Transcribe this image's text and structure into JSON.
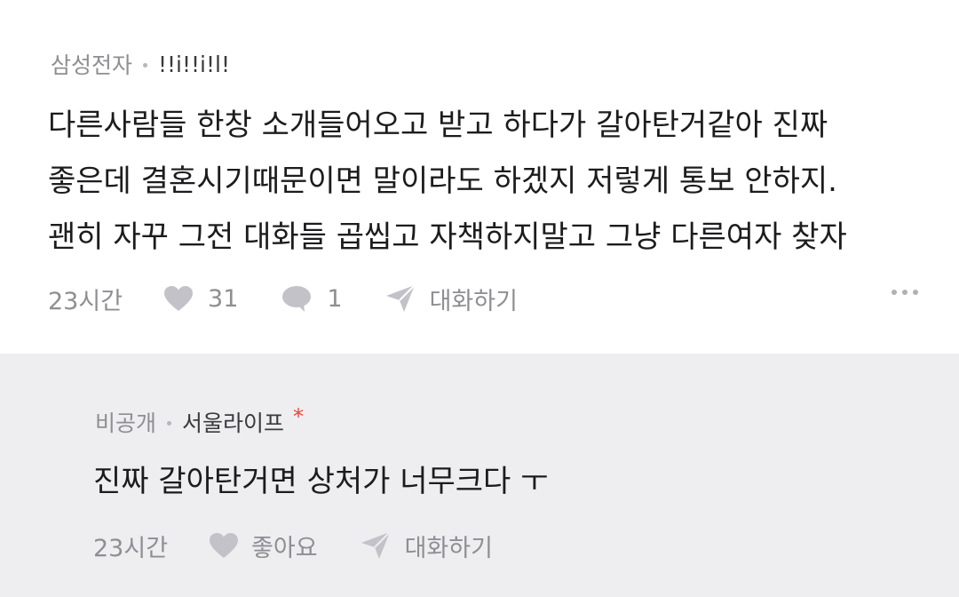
{
  "comment": {
    "company": "삼성전자",
    "nickname": "!!i!!i!l!",
    "lines": [
      "다른사람들 한창 소개들어오고 받고 하다가 갈아탄거같아 진짜",
      "좋은데 결혼시기때문이면 말이라도 하겠지 저렇게 통보 안하지.",
      "괜히 자꾸 그전 대화들 곱씹고 자책하지말고 그냥 다른여자 찾자"
    ],
    "time": "23시간",
    "likes": "31",
    "replies": "1",
    "chat_label": "대화하기"
  },
  "reply": {
    "company": "비공개",
    "nickname": "서울라이프",
    "author_mark": "*",
    "text": "진짜 갈아탄거면 상처가 너무크다 ㅜ",
    "time": "23시간",
    "like_label": "좋아요",
    "chat_label": "대화하기"
  },
  "colors": {
    "reply_background": "#eeeef0",
    "author_mark": "#e8453c",
    "meta_text": "#8e8e93",
    "body_text": "#1c1c1e"
  }
}
